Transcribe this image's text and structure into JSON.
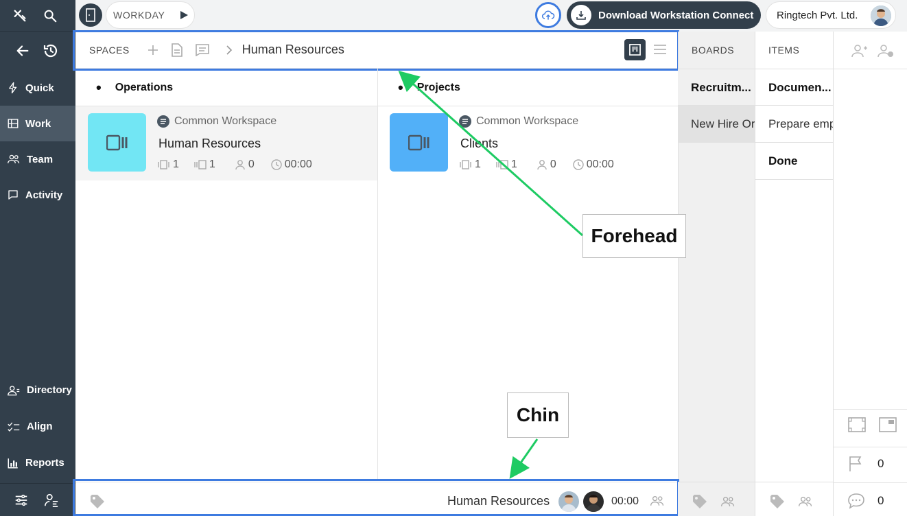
{
  "sidebar": {
    "items": [
      {
        "label": "Quick",
        "icon": "bolt-icon"
      },
      {
        "label": "Work",
        "icon": "grid-icon"
      },
      {
        "label": "Team",
        "icon": "team-icon"
      },
      {
        "label": "Activity",
        "icon": "chat-icon"
      }
    ],
    "bottom_items": [
      {
        "label": "Directory",
        "icon": "directory-icon"
      },
      {
        "label": "Align",
        "icon": "checklist-icon"
      },
      {
        "label": "Reports",
        "icon": "bar-chart-icon"
      }
    ]
  },
  "topbar": {
    "workday_label": "WORKDAY",
    "download_label": "Download Workstation Connect",
    "company": "Ringtech Pvt. Ltd."
  },
  "breadcrumb": {
    "root": "SPACES",
    "current": "Human Resources"
  },
  "columns": {
    "boards_header": "BOARDS",
    "items_header": "ITEMS"
  },
  "groups": [
    {
      "name": "Operations",
      "card": {
        "workspace": "Common Workspace",
        "title": "Human Resources",
        "boards": "1",
        "items": "1",
        "members": "0",
        "time": "00:00",
        "color": "#72e6f4"
      }
    },
    {
      "name": "Projects",
      "card": {
        "workspace": "Common Workspace",
        "title": "Clients",
        "boards": "1",
        "items": "1",
        "members": "0",
        "time": "00:00",
        "color": "#52b0f8"
      }
    }
  ],
  "boards": [
    {
      "label": "Recruitm..."
    },
    {
      "label": "New Hire Or"
    }
  ],
  "items": [
    {
      "label": "Documen..."
    },
    {
      "label": "Prepare emp"
    },
    {
      "label": "Done"
    }
  ],
  "footer": {
    "space_name": "Human Resources",
    "time": "00:00"
  },
  "right_panel": {
    "flag_count": "0",
    "comment_count": "0"
  },
  "annotations": {
    "forehead": "Forehead",
    "chin": "Chin"
  },
  "colors": {
    "sidebar": "#323f4b",
    "highlight": "#3e7be0",
    "arrow": "#1ecb63"
  }
}
